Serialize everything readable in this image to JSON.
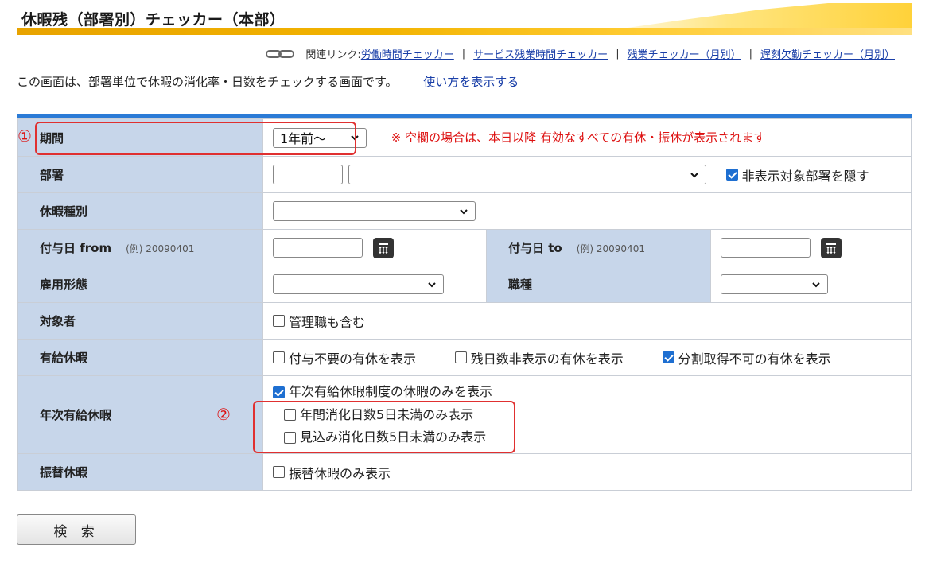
{
  "page": {
    "title": "休暇残（部署別）チェッカー（本部）",
    "description": "この画面は、部署単位で休暇の消化率・日数をチェックする画面です。",
    "howto_link": "使い方を表示する"
  },
  "related_links": {
    "prefix": "関連リンク:",
    "items": [
      "労働時間チェッカー",
      "サービス残業時間チェッカー",
      "残業チェッカー（月別）",
      "遅刻欠勤チェッカー（月別）"
    ],
    "separator": "|"
  },
  "icons": {
    "related": "chain-link-icon",
    "calendar": "calendar-icon",
    "dropdown": "chevron-down-icon",
    "checkbox": "check-icon"
  },
  "colors": {
    "accent_blue": "#2b7bd6",
    "label_bg": "#c7d6ea",
    "annotation_red": "#e03030",
    "title_band": "#f2b300"
  },
  "markers": {
    "one": "①",
    "two": "②"
  },
  "form": {
    "period": {
      "label": "期間",
      "selected": "1年前～",
      "note": "※ 空欄の場合は、本日以降 有効なすべての有休・振休が表示されます"
    },
    "department": {
      "label": "部署",
      "code_value": "",
      "select_value": "",
      "hide_checkbox": {
        "label": "非表示対象部署を隠す",
        "checked": true
      }
    },
    "leave_type": {
      "label": "休暇種別",
      "selected": ""
    },
    "grant_from": {
      "label": "付与日 from",
      "example": "(例) 20090401",
      "value": ""
    },
    "grant_to": {
      "label": "付与日 to",
      "example": "(例) 20090401",
      "value": ""
    },
    "employment_type": {
      "label": "雇用形態",
      "selected": ""
    },
    "job_type": {
      "label": "職種",
      "selected": ""
    },
    "target": {
      "label": "対象者",
      "checkbox": {
        "label": "管理職も含む",
        "checked": false
      }
    },
    "paid_leave": {
      "label": "有給休暇",
      "checkboxes": [
        {
          "label": "付与不要の有休を表示",
          "checked": false
        },
        {
          "label": "残日数非表示の有休を表示",
          "checked": false
        },
        {
          "label": "分割取得不可の有休を表示",
          "checked": true
        }
      ]
    },
    "annual_paid_leave": {
      "label": "年次有給休暇",
      "checkboxes": [
        {
          "label": "年次有給休暇制度の休暇のみを表示",
          "checked": true
        },
        {
          "label": "年間消化日数5日未満のみ表示",
          "checked": false
        },
        {
          "label": "見込み消化日数5日未満のみ表示",
          "checked": false
        }
      ]
    },
    "substitute_leave": {
      "label": "振替休暇",
      "checkbox": {
        "label": "振替休暇のみ表示",
        "checked": false
      }
    }
  },
  "search_button": "検 索"
}
